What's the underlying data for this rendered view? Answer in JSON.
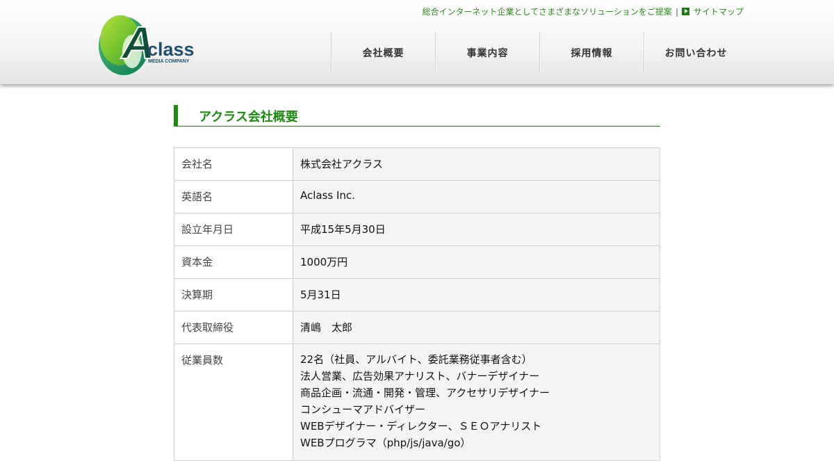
{
  "header": {
    "tagline": "総合インターネット企業としてさまざまなソリューションをご提案",
    "separator": "|",
    "sitemap_label": "サイトマップ",
    "logo": {
      "main_text": "class",
      "letter": "A",
      "sub_text": "MEDIA COMPANY"
    },
    "nav": [
      {
        "label": "会社概要"
      },
      {
        "label": "事業内容"
      },
      {
        "label": "採用情報"
      },
      {
        "label": "お問い合わせ"
      }
    ]
  },
  "main": {
    "title": "アクラス会社概要",
    "rows": [
      {
        "label": "会社名",
        "value": "株式会社アクラス"
      },
      {
        "label": "英語名",
        "value": "Aclass Inc."
      },
      {
        "label": "設立年月日",
        "value": "平成15年5月30日"
      },
      {
        "label": "資本金",
        "value": "1000万円"
      },
      {
        "label": "決算期",
        "value": "5月31日"
      },
      {
        "label": "代表取締役",
        "value": "清嶋　太郎"
      }
    ],
    "employees": {
      "label": "従業員数",
      "lines": [
        "22名（社員、アルバイト、委託業務従事者含む）",
        "法人営業、広告効果アナリスト、バナーデザイナー",
        "商品企画・流通・開発・管理、アクセサリデザイナー",
        "コンシューマアドバイザー",
        "WEBデザイナー・ディレクター、ＳＥＯアナリスト",
        "WEBプログラマ（php/js/java/go）"
      ]
    }
  },
  "colors": {
    "accent_green": "#1e8a14",
    "tagline_green": "#2e8b1e",
    "cell_bg": "#f4f4f4",
    "border": "#cfcfcf"
  },
  "icons": {
    "sitemap": "play-icon",
    "logo": "aclass-logo-icon"
  }
}
